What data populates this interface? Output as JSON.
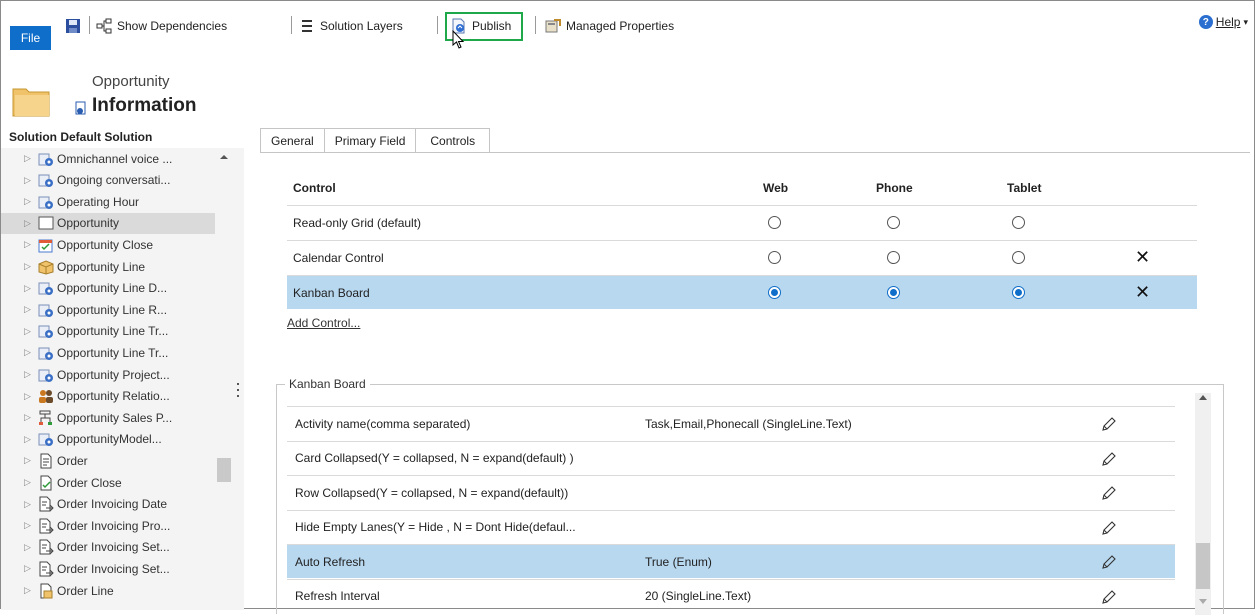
{
  "toolbar": {
    "file_label": "File",
    "show_dependencies": "Show Dependencies",
    "solution_layers": "Solution Layers",
    "publish": "Publish",
    "managed_properties": "Managed Properties",
    "help": "Help",
    "help_caret": "▾",
    "highlight_color": "#1ea84a"
  },
  "entity": {
    "name": "Opportunity",
    "section": "Information"
  },
  "solution": {
    "title": "Solution Default Solution"
  },
  "tree": {
    "items": [
      {
        "label": "Omnichannel voice ...",
        "icon": "entity-gear-icon"
      },
      {
        "label": "Ongoing conversati...",
        "icon": "entity-gear-icon"
      },
      {
        "label": "Operating Hour",
        "icon": "entity-gear-icon"
      },
      {
        "label": "Opportunity",
        "icon": "entity-blank-icon",
        "selected": true
      },
      {
        "label": "Opportunity Close",
        "icon": "calendar-check-icon"
      },
      {
        "label": "Opportunity Line",
        "icon": "box-icon"
      },
      {
        "label": "Opportunity Line D...",
        "icon": "entity-gear-icon"
      },
      {
        "label": "Opportunity Line R...",
        "icon": "entity-gear-icon"
      },
      {
        "label": "Opportunity Line Tr...",
        "icon": "entity-gear-icon"
      },
      {
        "label": "Opportunity Line Tr...",
        "icon": "entity-gear-icon"
      },
      {
        "label": "Opportunity Project...",
        "icon": "entity-gear-icon"
      },
      {
        "label": "Opportunity Relatio...",
        "icon": "people-icon"
      },
      {
        "label": "Opportunity Sales P...",
        "icon": "process-icon"
      },
      {
        "label": "OpportunityModel...",
        "icon": "entity-gear-icon"
      },
      {
        "label": "Order",
        "icon": "document-icon"
      },
      {
        "label": "Order Close",
        "icon": "document-check-icon"
      },
      {
        "label": "Order Invoicing Date",
        "icon": "document-arrow-icon"
      },
      {
        "label": "Order Invoicing Pro...",
        "icon": "document-arrow-icon"
      },
      {
        "label": "Order Invoicing Set...",
        "icon": "document-arrow-icon"
      },
      {
        "label": "Order Invoicing Set...",
        "icon": "document-arrow-icon"
      },
      {
        "label": "Order Line",
        "icon": "document-box-icon"
      }
    ]
  },
  "tabs": [
    "General",
    "Primary Field",
    "Controls"
  ],
  "active_tab": "Controls",
  "controls": {
    "headers": {
      "control": "Control",
      "web": "Web",
      "phone": "Phone",
      "tablet": "Tablet"
    },
    "rows": [
      {
        "name": "Read-only Grid (default)",
        "web": false,
        "phone": false,
        "tablet": false,
        "removable": false
      },
      {
        "name": "Calendar Control",
        "web": false,
        "phone": false,
        "tablet": false,
        "removable": true
      },
      {
        "name": "Kanban Board",
        "web": true,
        "phone": true,
        "tablet": true,
        "removable": true,
        "selected": true
      }
    ],
    "add_control": "Add Control...",
    "remove_glyph": "✕"
  },
  "kanban": {
    "legend": "Kanban Board",
    "properties": [
      {
        "name": "Activity name(comma separated)",
        "value": "Task,Email,Phonecall (SingleLine.Text)"
      },
      {
        "name": "Card Collapsed(Y = collapsed, N = expand(default) )",
        "value": ""
      },
      {
        "name": "Row Collapsed(Y = collapsed, N = expand(default))",
        "value": ""
      },
      {
        "name": "Hide Empty Lanes(Y = Hide , N = Dont Hide(defaul...",
        "value": ""
      },
      {
        "name": "Auto Refresh",
        "value": "True (Enum)",
        "selected": true
      },
      {
        "name": "Refresh Interval",
        "value": "20 (SingleLine.Text)"
      }
    ]
  },
  "colors": {
    "file_button": "#0f6ec9",
    "selected_row": "#b8d8f0",
    "radio_on": "#0f6ec9"
  }
}
